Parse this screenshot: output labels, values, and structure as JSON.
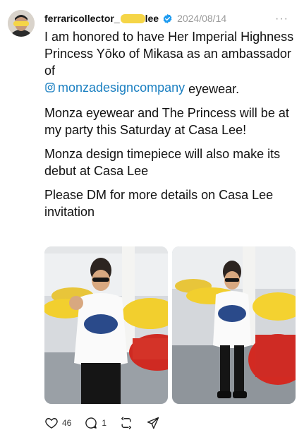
{
  "post": {
    "username_part1": "ferraricollector_",
    "username_part2": "lee",
    "verified": true,
    "date": "2024/08/14",
    "more_label": "···",
    "paragraph1_text": "I am honored to have Her Imperial Highness Princess Yōko of Mikasa as an ambassador of",
    "mention": "monzadesigncompany",
    "paragraph1_tail": " eyewear.",
    "paragraph2": "Monza eyewear and The Princess will be at my party this Saturday at Casa Lee!",
    "paragraph3": "Monza design timepiece will also make its debut at Casa Lee",
    "paragraph4": "Please DM for more details on Casa Lee invitation"
  },
  "actions": {
    "likes": "46",
    "replies": "1"
  },
  "colors": {
    "mention": "#1a7fc1",
    "verified": "#1d9bf0",
    "redaction": "#f5d547"
  },
  "icons": [
    "heart-icon",
    "reply-icon",
    "repost-icon",
    "share-icon",
    "instagram-icon",
    "verified-icon"
  ]
}
